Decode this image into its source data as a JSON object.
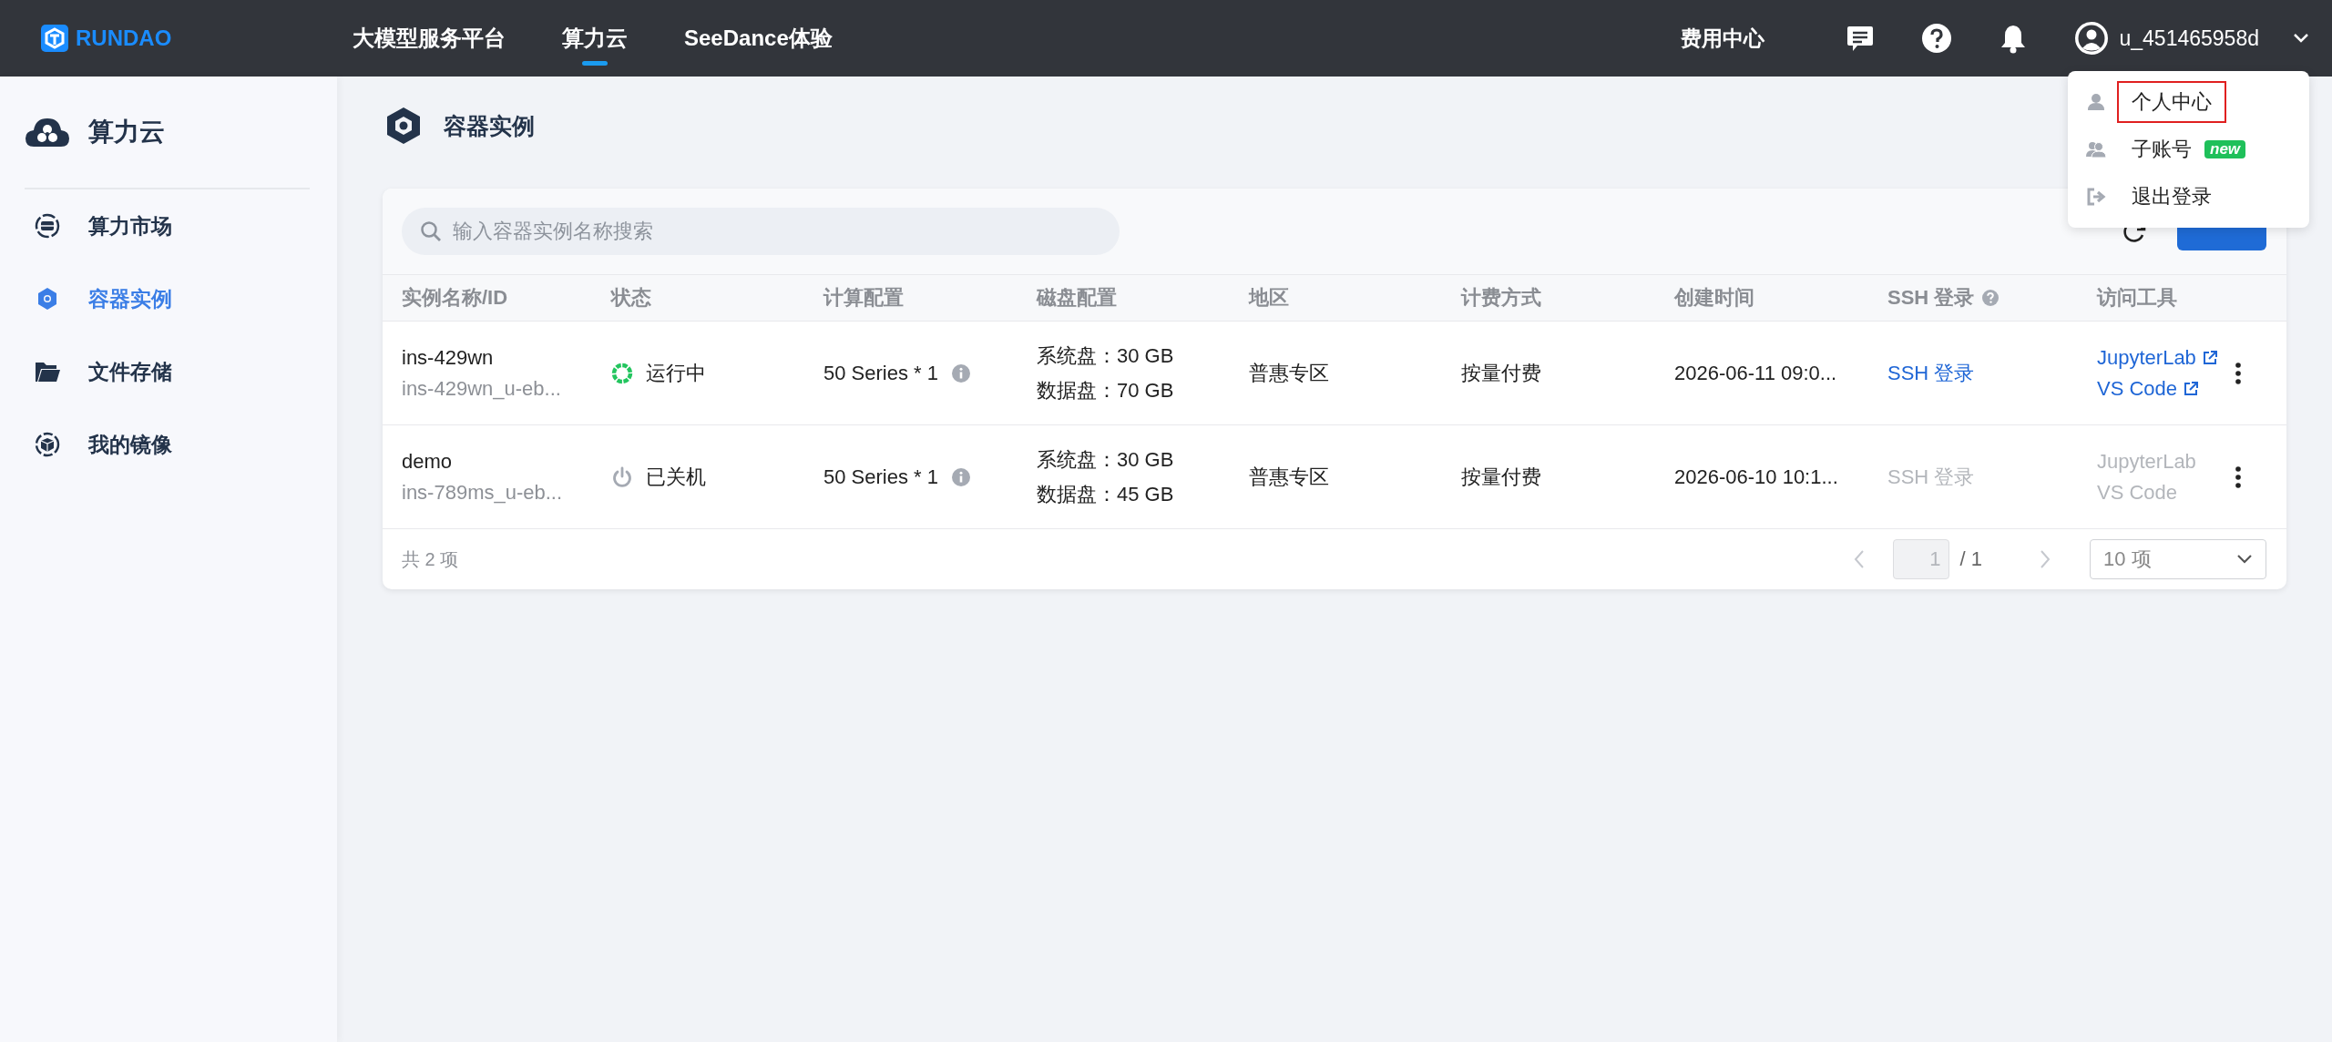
{
  "topbar": {
    "brand": "RUNDAO",
    "nav": [
      {
        "label": "大模型服务平台",
        "selected": false
      },
      {
        "label": "算力云",
        "selected": true
      },
      {
        "label": "SeeDance体验",
        "selected": false
      }
    ],
    "billing": "费用中心",
    "username": "u_451465958d"
  },
  "user_menu": {
    "items": [
      {
        "kind": "profile",
        "label": "个人中心",
        "highlighted": true
      },
      {
        "kind": "subaccount",
        "label": "子账号",
        "badge": "new",
        "highlighted": false
      },
      {
        "kind": "logout",
        "label": "退出登录",
        "highlighted": false
      }
    ]
  },
  "sidebar": {
    "title": "算力云",
    "items": [
      {
        "kind": "market",
        "label": "算力市场",
        "selected": false
      },
      {
        "kind": "container",
        "label": "容器实例",
        "selected": true
      },
      {
        "kind": "folder",
        "label": "文件存储",
        "selected": false
      },
      {
        "kind": "image",
        "label": "我的镜像",
        "selected": false
      }
    ]
  },
  "page": {
    "title": "容器实例"
  },
  "toolbar": {
    "search": {
      "placeholder": "输入容器实例名称搜索"
    },
    "create_button": {
      "kind": "primary"
    }
  },
  "table": {
    "columns": [
      "实例名称/ID",
      "状态",
      "计算配置",
      "磁盘配置",
      "地区",
      "计费方式",
      "创建时间",
      "SSH 登录",
      "访问工具"
    ],
    "rows": [
      {
        "name": "ins-429wn",
        "id": "ins-429wn_u-eb...",
        "status": {
          "kind": "running",
          "label": "运行中"
        },
        "compute": "50 Series * 1",
        "disks": [
          "系统盘：30 GB",
          "数据盘：70 GB"
        ],
        "region": "普惠专区",
        "billing": "按量付费",
        "created": "2026-06-11 09:0...",
        "ssh": {
          "label": "SSH 登录",
          "enabled": true
        },
        "tools": [
          {
            "label": "JupyterLab",
            "enabled": true
          },
          {
            "label": "VS Code",
            "enabled": true
          }
        ]
      },
      {
        "name": "demo",
        "id": "ins-789ms_u-eb...",
        "status": {
          "kind": "stopped",
          "label": "已关机"
        },
        "compute": "50 Series * 1",
        "disks": [
          "系统盘：30 GB",
          "数据盘：45 GB"
        ],
        "region": "普惠专区",
        "billing": "按量付费",
        "created": "2026-06-10 10:1...",
        "ssh": {
          "label": "SSH 登录",
          "enabled": false
        },
        "tools": [
          {
            "label": "JupyterLab",
            "enabled": false
          },
          {
            "label": "VS Code",
            "enabled": false
          }
        ]
      }
    ]
  },
  "footer": {
    "total": "共 2 项",
    "page": "1",
    "pages": "/ 1",
    "page_size": "10 项"
  }
}
